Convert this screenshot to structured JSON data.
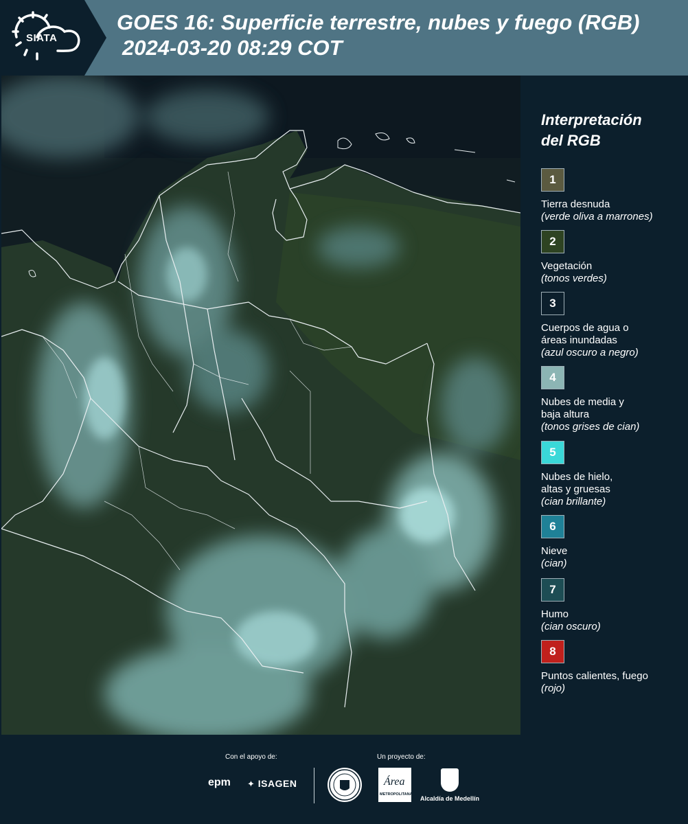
{
  "header": {
    "logo_text": "SIATA",
    "title_line1": "GOES 16: Superficie terrestre, nubes y fuego (RGB)",
    "title_line2": "2024-03-20 08:29 COT"
  },
  "legend": {
    "title_line1": "Interpretación",
    "title_line2": "del RGB",
    "items": [
      {
        "number": "1",
        "label": "Tierra desnuda",
        "sub": "(verde oliva a marrones)",
        "color": "#5b5a40"
      },
      {
        "number": "2",
        "label": "Vegetación",
        "sub": "(tonos verdes)",
        "color": "#2e4322"
      },
      {
        "number": "3",
        "label": "Cuerpos de agua o áreas inundadas",
        "sub": "(azul oscuro a negro)",
        "color": "#0c1f2c"
      },
      {
        "number": "4",
        "label": "Nubes de media y baja altura",
        "sub": "(tonos grises de cian)",
        "color": "#8cb5b4"
      },
      {
        "number": "5",
        "label": "Nubes de hielo, altas y gruesas",
        "sub": "(cian brillante)",
        "color": "#3ad8d8"
      },
      {
        "number": "6",
        "label": "Nieve",
        "sub": "(cian)",
        "color": "#1f8197"
      },
      {
        "number": "7",
        "label": "Humo",
        "sub": "(cian oscuro)",
        "color": "#1d4d54"
      },
      {
        "number": "8",
        "label": "Puntos calientes, fuego",
        "sub": "(rojo)",
        "color": "#c0201c"
      }
    ]
  },
  "footer": {
    "support_label": "Con el apoyo de:",
    "project_label": "Un proyecto de:",
    "epm": "epm",
    "isagen": "ISAGEN",
    "area_metro_name": "Área",
    "area_metro_sub": "METROPOLITANA",
    "alcaldia": "Alcaldía de Medellín"
  }
}
